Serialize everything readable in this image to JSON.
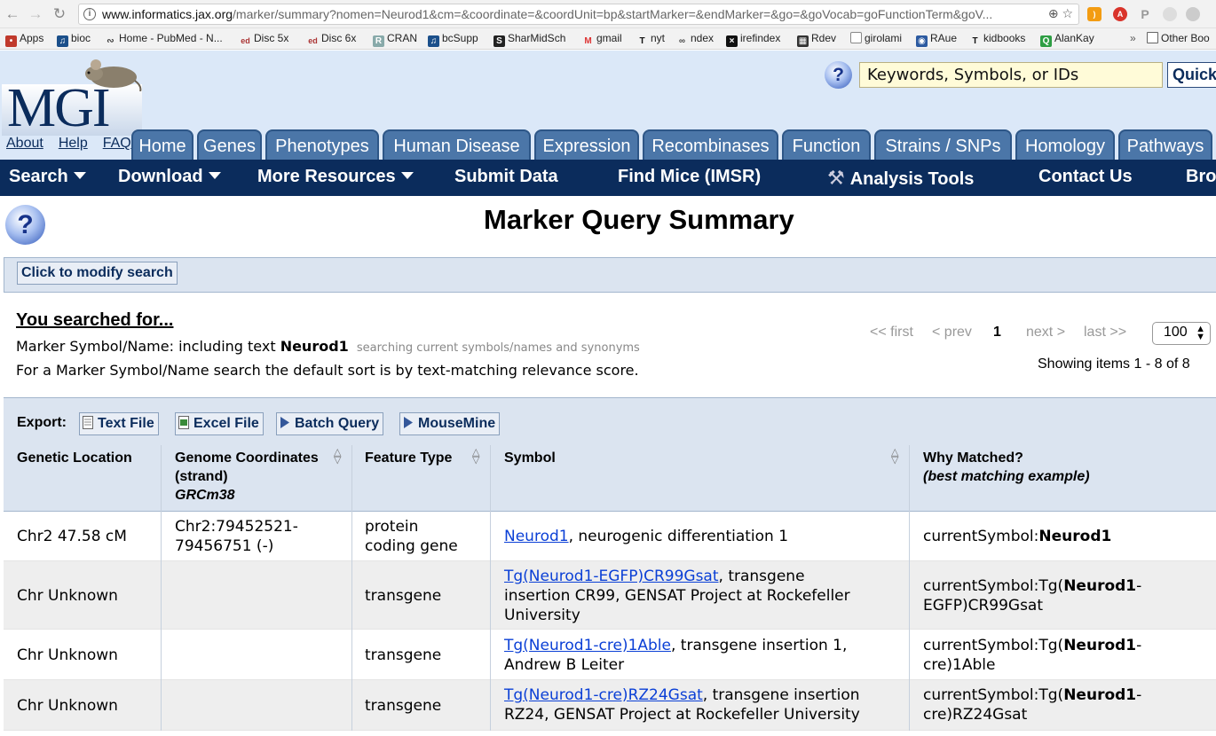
{
  "browser": {
    "url_host": "www.informatics.jax.org",
    "url_path": "/marker/summary?nomen=Neurod1&cm=&coordinate=&coordUnit=bp&startMarker=&endMarker=&go=&goVocab=goFunctionTerm&goV...",
    "bookmarks": [
      "Apps",
      "bioc",
      "Home - PubMed - N...",
      "Disc 5x",
      "Disc 6x",
      "CRAN",
      "bcSupp",
      "SharMidSch",
      "gmail",
      "nyt",
      "ndex",
      "irefindex",
      "Rdev",
      "girolami",
      "RAue",
      "kidbooks",
      "AlanKay",
      "Other Boo"
    ]
  },
  "header": {
    "logo": "MGI",
    "search_placeholder": "Keywords, Symbols, or IDs",
    "quick_button": "Quick",
    "util_links": [
      "About",
      "Help",
      "FAQ"
    ],
    "tabs": [
      "Home",
      "Genes",
      "Phenotypes",
      "Human Disease",
      "Expression",
      "Recombinases",
      "Function",
      "Strains / SNPs",
      "Homology",
      "Pathways"
    ],
    "nav": [
      "Search",
      "Download",
      "More Resources",
      "Submit Data",
      "Find Mice (IMSR)",
      "Analysis Tools",
      "Contact Us",
      "Bro"
    ]
  },
  "page": {
    "title": "Marker Query Summary",
    "modify_button": "Click to modify search",
    "searched_heading": "You searched for...",
    "searched_prefix": "Marker Symbol/Name: including text",
    "searched_term": "Neurod1",
    "searched_note": "searching current symbols/names and synonyms",
    "sort_note": "For a Marker Symbol/Name search the default sort is by text-matching relevance score."
  },
  "pager": {
    "first": "<< first",
    "prev": "< prev",
    "current": "1",
    "next": "next >",
    "last": "last >>",
    "page_size": "100",
    "showing": "Showing items 1 - 8 of 8"
  },
  "export": {
    "label": "Export:",
    "buttons": [
      "Text File",
      "Excel File",
      "Batch Query",
      "MouseMine"
    ]
  },
  "table": {
    "headers": {
      "genetic_location": "Genetic Location",
      "coords_l1": "Genome Coordinates",
      "coords_l2": "(strand)",
      "coords_l3": "GRCm38",
      "feature_type": "Feature Type",
      "symbol": "Symbol",
      "why_l1": "Why Matched?",
      "why_l2": "(best matching example)"
    },
    "rows": [
      {
        "location": "Chr2 47.58 cM",
        "coords_l1": "Chr2:79452521-",
        "coords_l2": "79456751 (-)",
        "feature_l1": "protein",
        "feature_l2": "coding gene",
        "symbol_link": "Neurod1",
        "symbol_rest_l1": ", neurogenic differentiation 1",
        "symbol_rest_l2": "",
        "symbol_rest_l3": "",
        "why_prefix": "currentSymbol:",
        "why_bold": "Neurod1",
        "why_suffix_l1": "",
        "why_suffix_l2": ""
      },
      {
        "location": "Chr Unknown",
        "coords_l1": "",
        "coords_l2": "",
        "feature_l1": "transgene",
        "feature_l2": "",
        "symbol_link": "Tg(Neurod1-EGFP)CR99Gsat",
        "symbol_rest_l1": ", transgene",
        "symbol_rest_l2": "insertion CR99, GENSAT Project at Rockefeller",
        "symbol_rest_l3": "University",
        "why_prefix": "currentSymbol:Tg(",
        "why_bold": "Neurod1",
        "why_suffix_l1": "-",
        "why_suffix_l2": "EGFP)CR99Gsat"
      },
      {
        "location": "Chr Unknown",
        "coords_l1": "",
        "coords_l2": "",
        "feature_l1": "transgene",
        "feature_l2": "",
        "symbol_link": "Tg(Neurod1-cre)1Able",
        "symbol_rest_l1": ", transgene insertion 1,",
        "symbol_rest_l2": "Andrew B Leiter",
        "symbol_rest_l3": "",
        "why_prefix": "currentSymbol:Tg(",
        "why_bold": "Neurod1",
        "why_suffix_l1": "-",
        "why_suffix_l2": "cre)1Able"
      },
      {
        "location": "Chr Unknown",
        "coords_l1": "",
        "coords_l2": "",
        "feature_l1": "transgene",
        "feature_l2": "",
        "symbol_link": "Tg(Neurod1-cre)RZ24Gsat",
        "symbol_rest_l1": ", transgene insertion",
        "symbol_rest_l2": "RZ24, GENSAT Project at Rockefeller University",
        "symbol_rest_l3": "",
        "why_prefix": "currentSymbol:Tg(",
        "why_bold": "Neurod1",
        "why_suffix_l1": "-",
        "why_suffix_l2": "cre)RZ24Gsat"
      }
    ]
  },
  "colors": {
    "header_bg": "#dbe8f8",
    "tab_bg": "#4b76a8",
    "navbar_bg": "#0b2c5c",
    "table_header_bg": "#dbe4f0",
    "alt_row_bg": "#eeeeee",
    "link": "#0a3fd6"
  }
}
